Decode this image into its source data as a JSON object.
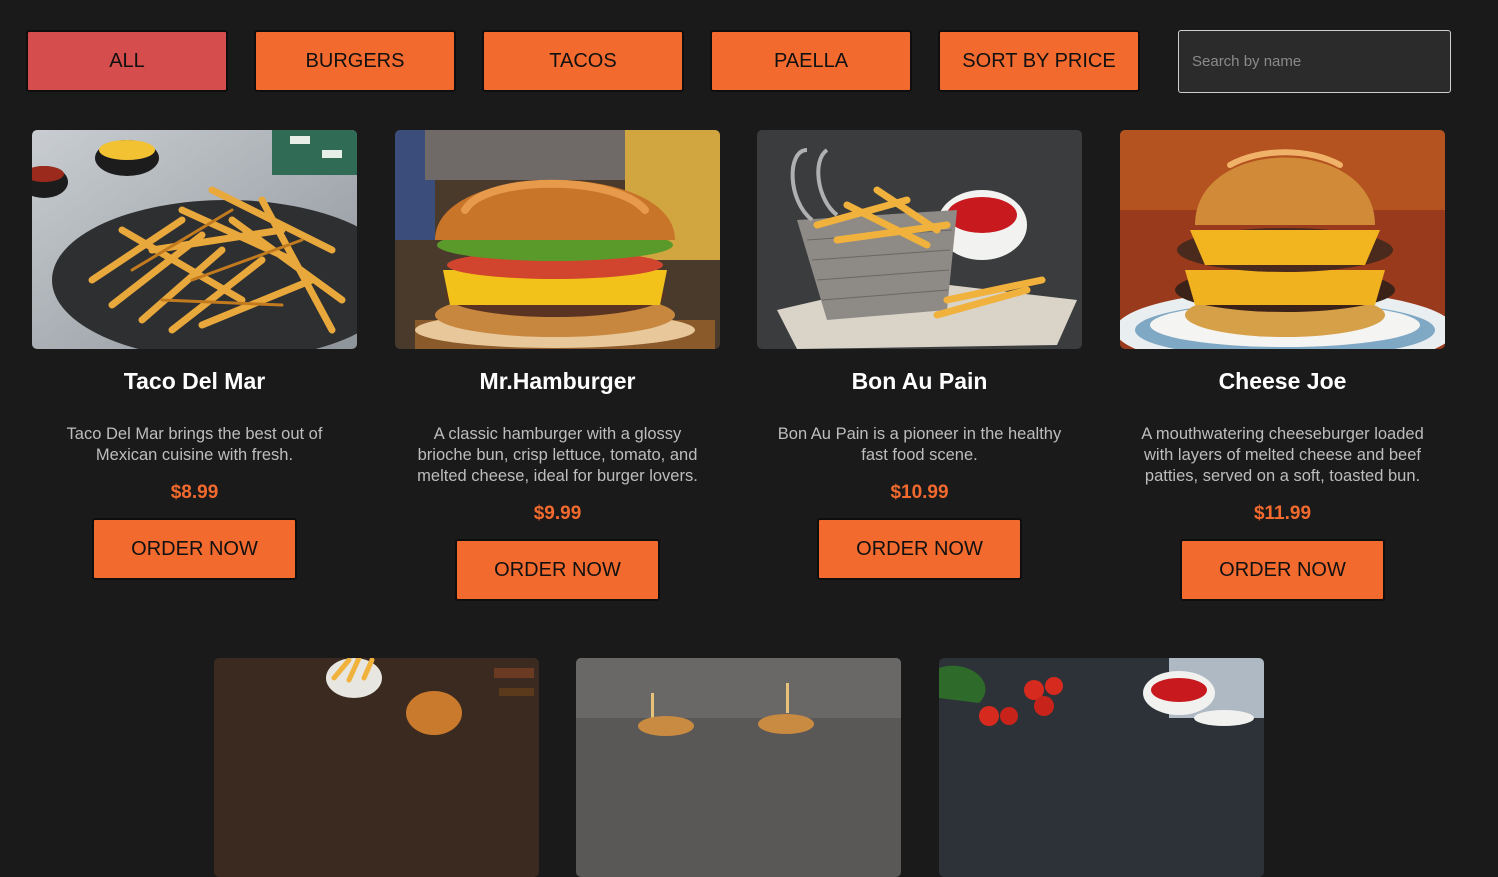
{
  "filters": {
    "all": "ALL",
    "burgers": "BURGERS",
    "tacos": "TACOS",
    "paella": "PAELLA",
    "sort": "SORT BY PRICE"
  },
  "search": {
    "placeholder": "Search by name"
  },
  "colors": {
    "accent": "#f26a2e",
    "active": "#d54d4d",
    "background": "#1a1a1a"
  },
  "items": [
    {
      "name": "Taco Del Mar",
      "description": "Taco Del Mar brings the best out of Mexican cuisine with fresh.",
      "price": "$8.99",
      "button": "ORDER NOW",
      "image": "fries-on-slate-image"
    },
    {
      "name": "Mr.Hamburger",
      "description": "A classic hamburger with a glossy brioche bun, crisp lettuce, tomato, and melted cheese, ideal for burger lovers.",
      "price": "$9.99",
      "button": "ORDER NOW",
      "image": "hamburger-image"
    },
    {
      "name": "Bon Au Pain",
      "description": "Bon Au Pain is a pioneer in the healthy fast food scene.",
      "price": "$10.99",
      "button": "ORDER NOW",
      "image": "fries-basket-image"
    },
    {
      "name": "Cheese Joe",
      "description": "A mouthwatering cheeseburger loaded with layers of melted cheese and beef patties, served on a soft, toasted bun.",
      "price": "$11.99",
      "button": "ORDER NOW",
      "image": "cheeseburger-image"
    },
    {
      "image": "burger-and-fries-image"
    },
    {
      "image": "slider-burgers-image"
    },
    {
      "image": "tomatoes-ketchup-image"
    }
  ]
}
